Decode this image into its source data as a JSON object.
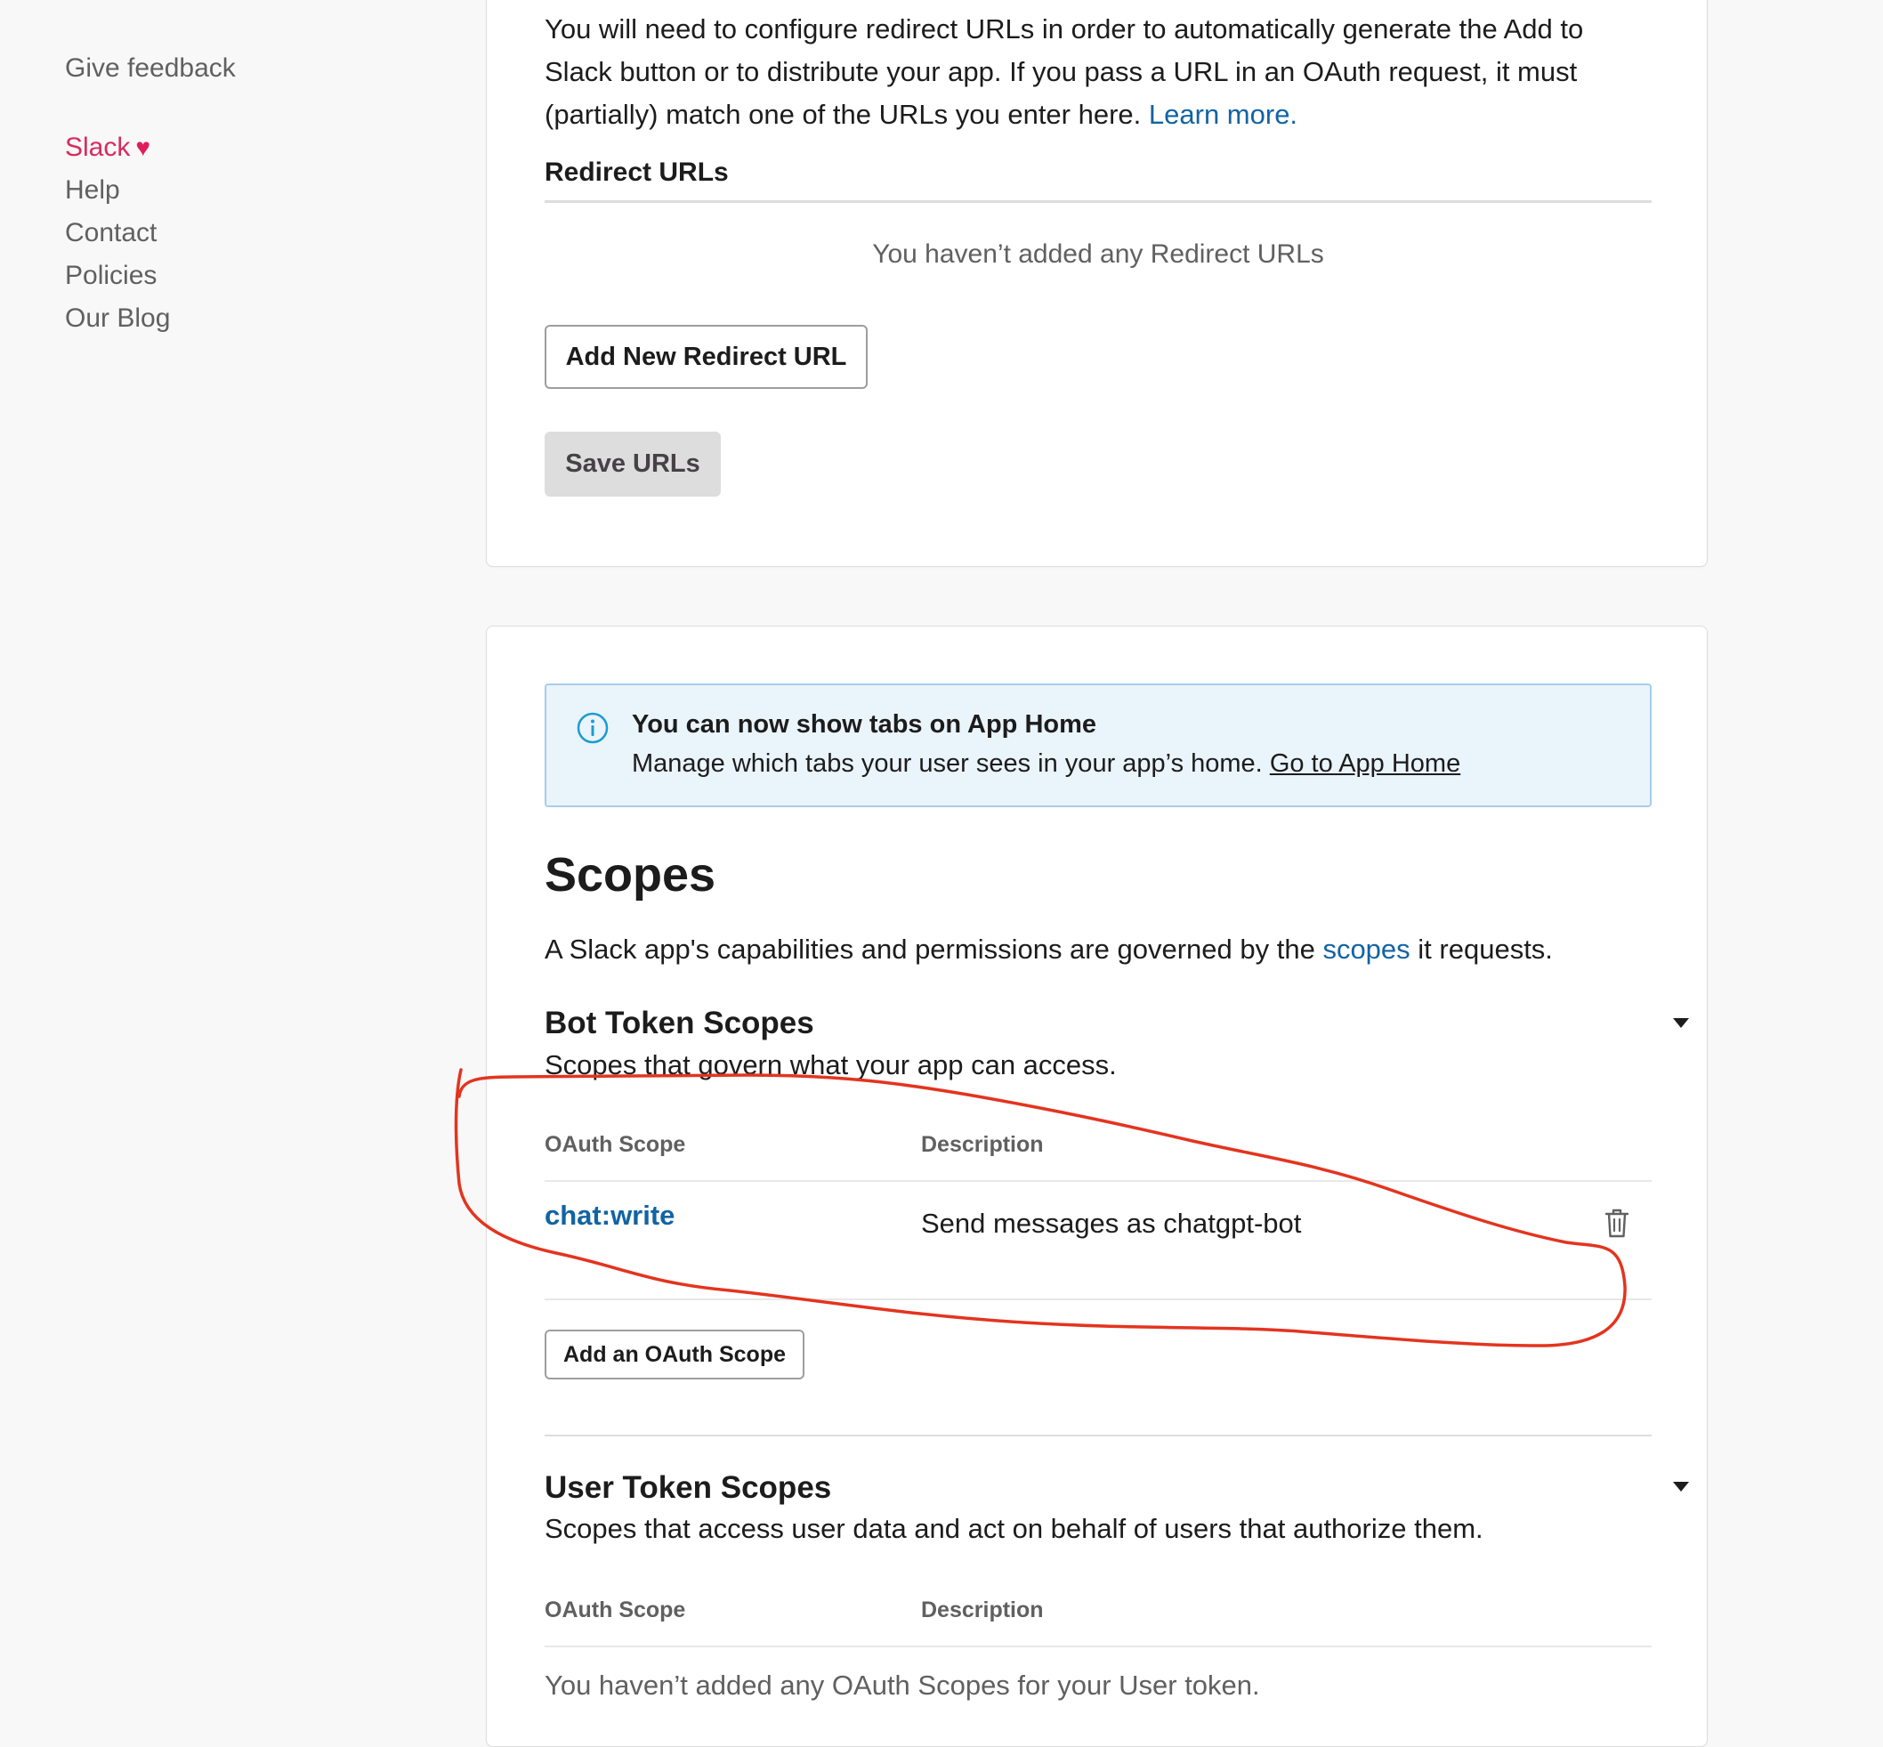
{
  "sidebar": {
    "feedback": "Give feedback",
    "links": [
      {
        "label": "Slack",
        "heart": "♥"
      },
      {
        "label": "Help"
      },
      {
        "label": "Contact"
      },
      {
        "label": "Policies"
      },
      {
        "label": "Our Blog"
      }
    ]
  },
  "redirect": {
    "intro_line1": "You will need to configure redirect URLs in order to automatically generate the Add to",
    "intro_line2": "Slack button or to distribute your app. If you pass a URL in an OAuth request, it must",
    "intro_line3": "(partially) match one of the URLs you enter here.",
    "learn_more": "Learn more.",
    "heading": "Redirect URLs",
    "empty_text": "You haven’t added any Redirect URLs",
    "add_button": "Add New Redirect URL",
    "save_button": "Save URLs"
  },
  "banner": {
    "icon": "info-icon",
    "title": "You can now show tabs on App Home",
    "body": "Manage which tabs your user sees in your app’s home.",
    "link": "Go to App Home"
  },
  "scopes": {
    "heading": "Scopes",
    "desc_before": "A Slack app's capabilities and permissions are governed by the",
    "desc_link": "scopes",
    "desc_after": "it requests.",
    "bot": {
      "title": "Bot Token Scopes",
      "subtitle": "Scopes that govern what your app can access.",
      "columns": [
        "OAuth Scope",
        "Description"
      ],
      "rows": [
        {
          "scope": "chat:write",
          "description": "Send messages as chatgpt-bot"
        }
      ],
      "add_button": "Add an OAuth Scope"
    },
    "user": {
      "title": "User Token Scopes",
      "subtitle": "Scopes that access user data and act on behalf of users that authorize them.",
      "columns": [
        "OAuth Scope",
        "Description"
      ],
      "empty_text": "You haven’t added any OAuth Scopes for your User token."
    }
  },
  "colors": {
    "link": "#1264a3",
    "brand": "#d72b5f",
    "banner_bg": "#eaf4fb",
    "banner_border": "#a6cde9",
    "annotation": "#e3341f"
  }
}
